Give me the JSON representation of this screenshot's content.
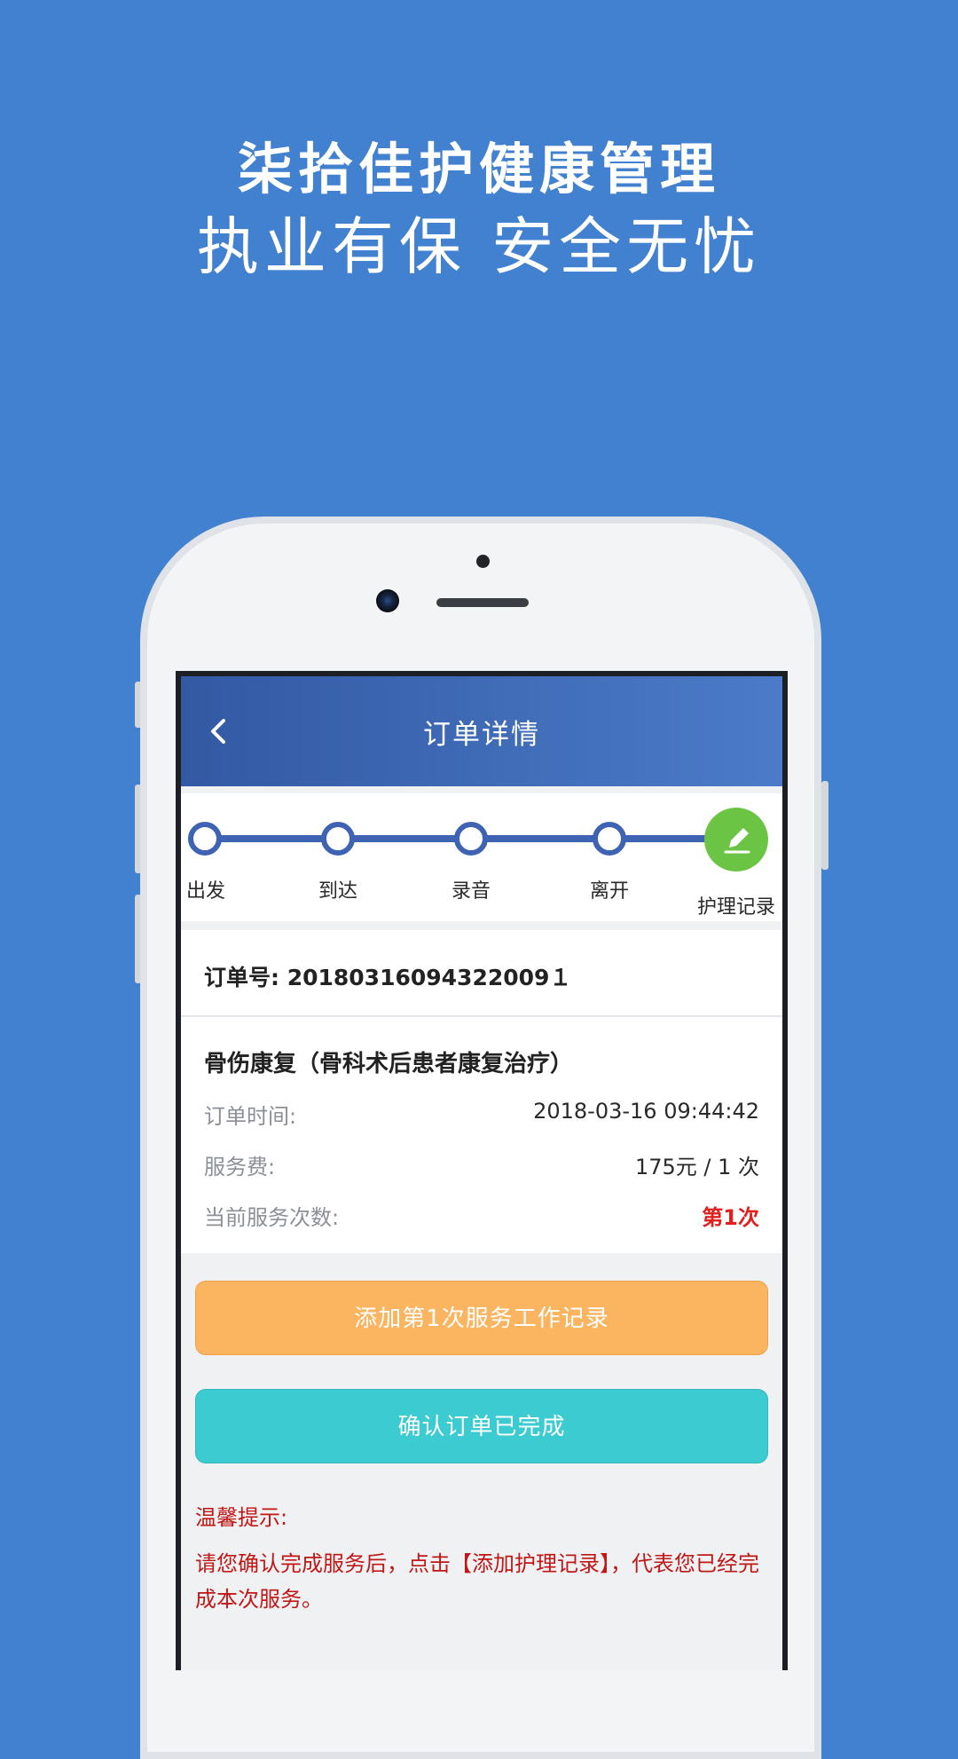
{
  "headline": {
    "line1": "柒拾佳护健康管理",
    "line2": "执业有保 安全无忧"
  },
  "navbar": {
    "title": "订单详情"
  },
  "steps": [
    {
      "label": "出发"
    },
    {
      "label": "到达"
    },
    {
      "label": "录音"
    },
    {
      "label": "离开"
    },
    {
      "label": "护理记录"
    }
  ],
  "order": {
    "order_no": "订单号: 20180316094322009１",
    "service_name": "骨伤康复（骨科术后患者康复治疗）",
    "time_label": "订单时间:",
    "time_value": "2018-03-16 09:44:42",
    "fee_label": "服务费:",
    "fee_value": "175元 / 1 次",
    "count_label": "当前服务次数:",
    "count_value": "第1次"
  },
  "actions": {
    "add_record_label": "添加第1次服务工作记录",
    "confirm_label": "确认订单已完成"
  },
  "tip": {
    "title": "温馨提示:",
    "body": "请您确认完成服务后，点击【添加护理记录】，代表您已经完成本次服务。"
  },
  "colors": {
    "background": "#4281cf",
    "navbar_start": "#3359a3",
    "navbar_end": "#4b7bc9",
    "step_line": "#3e63b2",
    "step_final": "#6cc444",
    "button_orange": "#fbb45f",
    "button_teal": "#3ccbd1",
    "highlight_red": "#e01f1f",
    "tip_red": "#c01717"
  },
  "icons": {
    "back": "chevron-left-icon",
    "final_step": "pencil-icon"
  }
}
